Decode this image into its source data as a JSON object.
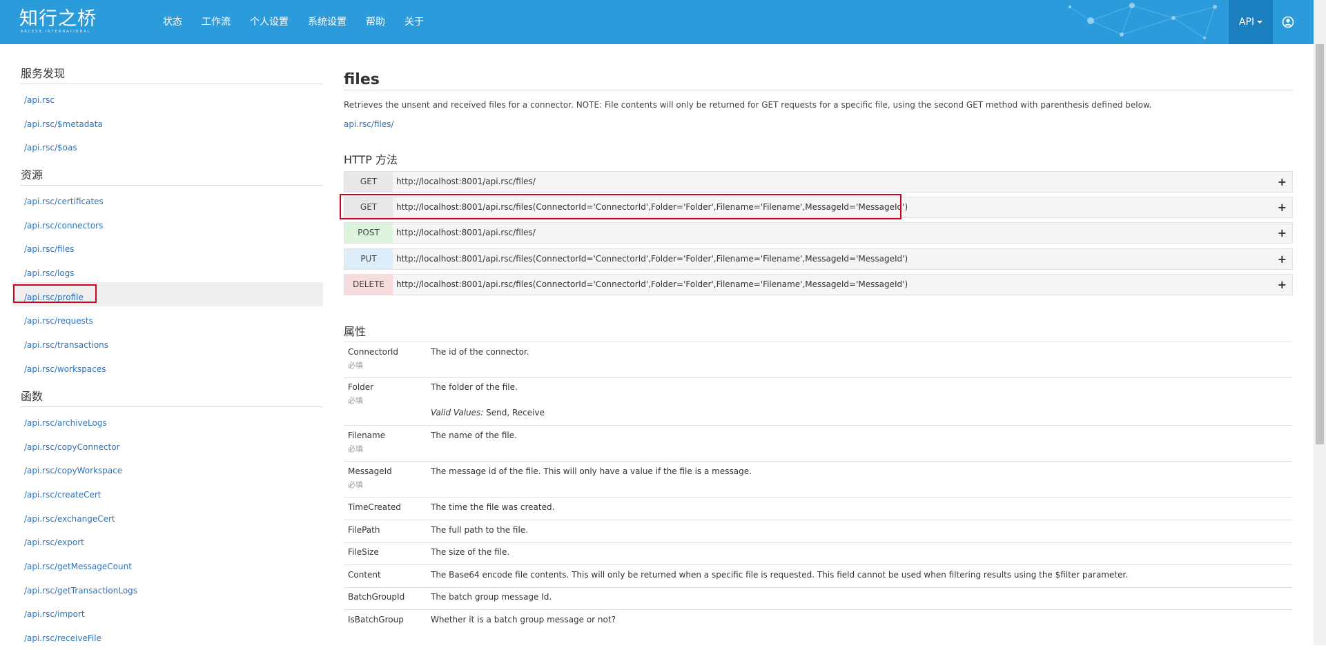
{
  "header": {
    "logo_text": "知行之桥",
    "logo_sub": "ARCESB INTERNATIONAL",
    "nav": [
      "状态",
      "工作流",
      "个人设置",
      "系统设置",
      "帮助",
      "关于"
    ],
    "api_label": "API"
  },
  "sidebar": {
    "sections": [
      {
        "title": "服务发现",
        "links": [
          "/api.rsc",
          "/api.rsc/$metadata",
          "/api.rsc/$oas"
        ]
      },
      {
        "title": "资源",
        "links": [
          "/api.rsc/certificates",
          "/api.rsc/connectors",
          "/api.rsc/files",
          "/api.rsc/logs",
          "/api.rsc/profile",
          "/api.rsc/requests",
          "/api.rsc/transactions",
          "/api.rsc/workspaces"
        ]
      },
      {
        "title": "函数",
        "links": [
          "/api.rsc/archiveLogs",
          "/api.rsc/copyConnector",
          "/api.rsc/copyWorkspace",
          "/api.rsc/createCert",
          "/api.rsc/exchangeCert",
          "/api.rsc/export",
          "/api.rsc/getMessageCount",
          "/api.rsc/getTransactionLogs",
          "/api.rsc/import",
          "/api.rsc/receiveFile"
        ]
      }
    ],
    "active_link": "/api.rsc/files"
  },
  "main": {
    "title": "files",
    "description": "Retrieves the unsent and received files for a connector. NOTE: File contents will only be returned for GET requests for a specific file, using the second GET method with parenthesis defined below.",
    "path": "api.rsc/files/",
    "methods_heading": "HTTP 方法",
    "methods": [
      {
        "verb": "GET",
        "url": "http://localhost:8001/api.rsc/files/",
        "color": "#e8e8e8"
      },
      {
        "verb": "GET",
        "url": "http://localhost:8001/api.rsc/files(ConnectorId='ConnectorId',Folder='Folder',Filename='Filename',MessageId='MessageId')",
        "color": "#e8e8e8"
      },
      {
        "verb": "POST",
        "url": "http://localhost:8001/api.rsc/files/",
        "color": "#dcf3dc"
      },
      {
        "verb": "PUT",
        "url": "http://localhost:8001/api.rsc/files(ConnectorId='ConnectorId',Folder='Folder',Filename='Filename',MessageId='MessageId')",
        "color": "#ddeefa"
      },
      {
        "verb": "DELETE",
        "url": "http://localhost:8001/api.rsc/files(ConnectorId='ConnectorId',Folder='Folder',Filename='Filename',MessageId='MessageId')",
        "color": "#f6dcdc"
      }
    ],
    "props_heading": "属性",
    "required_label": "必填",
    "valid_values_label": "Valid Values:",
    "properties": [
      {
        "name": "ConnectorId",
        "required": true,
        "desc": "The id of the connector.",
        "valid": ""
      },
      {
        "name": "Folder",
        "required": true,
        "desc": "The folder of the file.",
        "valid": "Send, Receive"
      },
      {
        "name": "Filename",
        "required": true,
        "desc": "The name of the file.",
        "valid": ""
      },
      {
        "name": "MessageId",
        "required": true,
        "desc": "The message id of the file. This will only have a value if the file is a message.",
        "valid": ""
      },
      {
        "name": "TimeCreated",
        "required": false,
        "desc": "The time the file was created.",
        "valid": ""
      },
      {
        "name": "FilePath",
        "required": false,
        "desc": "The full path to the file.",
        "valid": ""
      },
      {
        "name": "FileSize",
        "required": false,
        "desc": "The size of the file.",
        "valid": ""
      },
      {
        "name": "Content",
        "required": false,
        "desc": "The Base64 encode file contents. This will only be returned when a specific file is requested. This field cannot be used when filtering results using the $filter parameter.",
        "valid": ""
      },
      {
        "name": "BatchGroupId",
        "required": false,
        "desc": "The batch group message Id.",
        "valid": ""
      },
      {
        "name": "IsBatchGroup",
        "required": false,
        "desc": "Whether it is a batch group message or not?",
        "valid": ""
      }
    ]
  }
}
